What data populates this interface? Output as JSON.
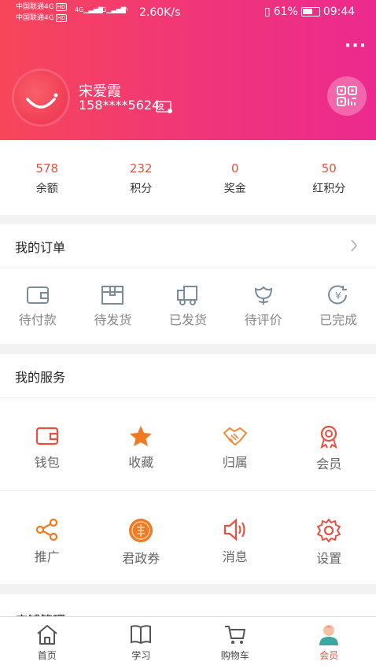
{
  "status_bar": {
    "carrier_1": "中国联通4G",
    "carrier_2": "中国联通4G",
    "hd_badge": "HD",
    "net_label": "4G",
    "speed": "2.60K/s",
    "battery": "61%",
    "time": "09:44"
  },
  "profile": {
    "name": "宋爱霞",
    "phone": "158****5624"
  },
  "stats": [
    {
      "value": "578",
      "label": "余额"
    },
    {
      "value": "232",
      "label": "积分"
    },
    {
      "value": "0",
      "label": "奖金"
    },
    {
      "value": "50",
      "label": "红积分"
    }
  ],
  "orders": {
    "title": "我的订单",
    "items": [
      {
        "label": "待付款",
        "icon": "wallet-icon"
      },
      {
        "label": "待发货",
        "icon": "box-icon"
      },
      {
        "label": "已发货",
        "icon": "truck-icon"
      },
      {
        "label": "待评价",
        "icon": "flower-icon"
      },
      {
        "label": "已完成",
        "icon": "yen-refresh-icon"
      }
    ]
  },
  "services": {
    "title": "我的服务",
    "items": [
      {
        "label": "钱包",
        "icon": "wallet-icon",
        "color": "#e8503f"
      },
      {
        "label": "收藏",
        "icon": "star-icon",
        "color": "#f07a22"
      },
      {
        "label": "归属",
        "icon": "handshake-icon",
        "color": "#f08a3a"
      },
      {
        "label": "会员",
        "icon": "medal-icon",
        "color": "#e8503f"
      },
      {
        "label": "推广",
        "icon": "share-icon",
        "color": "#f07a22"
      },
      {
        "label": "君政券",
        "icon": "coin-icon",
        "color": "#f07a22"
      },
      {
        "label": "消息",
        "icon": "speaker-icon",
        "color": "#e8503f"
      },
      {
        "label": "设置",
        "icon": "gear-icon",
        "color": "#e8503f"
      }
    ]
  },
  "store": {
    "title": "店铺管理"
  },
  "tabbar": {
    "tabs": [
      {
        "label": "首页",
        "icon": "home-icon"
      },
      {
        "label": "学习",
        "icon": "book-icon"
      },
      {
        "label": "购物车",
        "icon": "cart-icon"
      },
      {
        "label": "会员",
        "icon": "member-icon",
        "active": true
      }
    ]
  }
}
